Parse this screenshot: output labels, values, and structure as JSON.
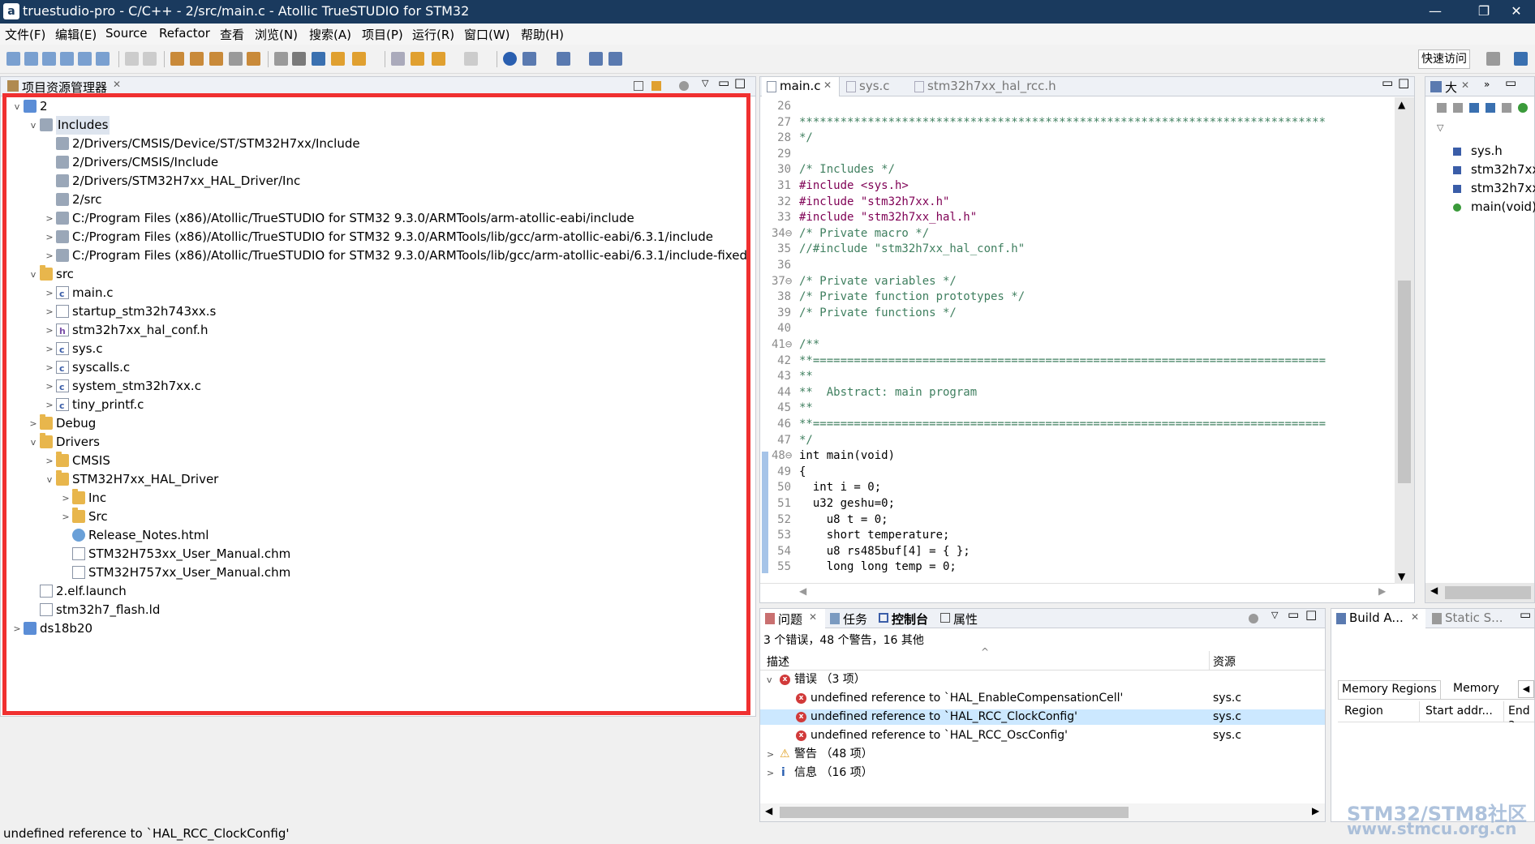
{
  "window": {
    "title": "truestudio-pro  -  C/C++  -  2/src/main.c  -  Atollic TrueSTUDIO for STM32",
    "minimize": "—",
    "maximize": "❐",
    "close": "✕"
  },
  "menu": [
    "文件(F)",
    "编辑(E)",
    "Source",
    "Refactor",
    "查看",
    "浏览(N)",
    "搜索(A)",
    "项目(P)",
    "运行(R)",
    "窗口(W)",
    "帮助(H)"
  ],
  "toolbar": {
    "quick_access": "快速访问"
  },
  "explorer": {
    "tab_label": "项目资源管理器",
    "tree": [
      {
        "depth": 0,
        "arrow": "open",
        "icon": "proj",
        "label": "2"
      },
      {
        "depth": 1,
        "arrow": "open",
        "icon": "inc",
        "label": "Includes",
        "selected": true
      },
      {
        "depth": 2,
        "arrow": "",
        "icon": "inc",
        "label": "2/Drivers/CMSIS/Device/ST/STM32H7xx/Include"
      },
      {
        "depth": 2,
        "arrow": "",
        "icon": "inc",
        "label": "2/Drivers/CMSIS/Include"
      },
      {
        "depth": 2,
        "arrow": "",
        "icon": "inc",
        "label": "2/Drivers/STM32H7xx_HAL_Driver/Inc"
      },
      {
        "depth": 2,
        "arrow": "",
        "icon": "inc",
        "label": "2/src"
      },
      {
        "depth": 2,
        "arrow": "closed",
        "icon": "inc",
        "label": "C:/Program Files (x86)/Atollic/TrueSTUDIO for STM32 9.3.0/ARMTools/arm-atollic-eabi/include"
      },
      {
        "depth": 2,
        "arrow": "closed",
        "icon": "inc",
        "label": "C:/Program Files (x86)/Atollic/TrueSTUDIO for STM32 9.3.0/ARMTools/lib/gcc/arm-atollic-eabi/6.3.1/include"
      },
      {
        "depth": 2,
        "arrow": "closed",
        "icon": "inc",
        "label": "C:/Program Files (x86)/Atollic/TrueSTUDIO for STM32 9.3.0/ARMTools/lib/gcc/arm-atollic-eabi/6.3.1/include-fixed"
      },
      {
        "depth": 1,
        "arrow": "open",
        "icon": "srcfolder",
        "label": "src"
      },
      {
        "depth": 2,
        "arrow": "closed",
        "icon": "cfile",
        "label": "main.c"
      },
      {
        "depth": 2,
        "arrow": "closed",
        "icon": "file",
        "label": "startup_stm32h743xx.s"
      },
      {
        "depth": 2,
        "arrow": "closed",
        "icon": "hfile",
        "label": "stm32h7xx_hal_conf.h"
      },
      {
        "depth": 2,
        "arrow": "closed",
        "icon": "cfile",
        "label": "sys.c"
      },
      {
        "depth": 2,
        "arrow": "closed",
        "icon": "cfile",
        "label": "syscalls.c"
      },
      {
        "depth": 2,
        "arrow": "closed",
        "icon": "cfile",
        "label": "system_stm32h7xx.c"
      },
      {
        "depth": 2,
        "arrow": "closed",
        "icon": "cfile",
        "label": "tiny_printf.c"
      },
      {
        "depth": 1,
        "arrow": "closed",
        "icon": "folder",
        "label": "Debug"
      },
      {
        "depth": 1,
        "arrow": "open",
        "icon": "folder",
        "label": "Drivers"
      },
      {
        "depth": 2,
        "arrow": "closed",
        "icon": "folder",
        "label": "CMSIS"
      },
      {
        "depth": 2,
        "arrow": "open",
        "icon": "folder",
        "label": "STM32H7xx_HAL_Driver"
      },
      {
        "depth": 3,
        "arrow": "closed",
        "icon": "folder",
        "label": "Inc"
      },
      {
        "depth": 3,
        "arrow": "closed",
        "icon": "folder",
        "label": "Src"
      },
      {
        "depth": 3,
        "arrow": "",
        "icon": "globe",
        "label": "Release_Notes.html"
      },
      {
        "depth": 3,
        "arrow": "",
        "icon": "file",
        "label": "STM32H753xx_User_Manual.chm"
      },
      {
        "depth": 3,
        "arrow": "",
        "icon": "file",
        "label": "STM32H757xx_User_Manual.chm"
      },
      {
        "depth": 1,
        "arrow": "",
        "icon": "file",
        "label": "2.elf.launch"
      },
      {
        "depth": 1,
        "arrow": "",
        "icon": "file",
        "label": "stm32h7_flash.ld"
      },
      {
        "depth": 0,
        "arrow": "closed",
        "icon": "proj",
        "label": "ds18b20"
      }
    ]
  },
  "editor": {
    "tabs": [
      {
        "label": "main.c",
        "active": true
      },
      {
        "label": "sys.c"
      },
      {
        "label": "stm32h7xx_hal_rcc.h"
      }
    ],
    "lines": [
      {
        "n": "26",
        "t": ""
      },
      {
        "n": "27",
        "t": "*****************************************************************************",
        "c": "cm"
      },
      {
        "n": "28",
        "t": "*/",
        "c": "cm"
      },
      {
        "n": "29",
        "t": ""
      },
      {
        "n": "30",
        "t": "/* Includes */",
        "c": "cm"
      },
      {
        "n": "31",
        "t": "#include <sys.h>",
        "c": "inc"
      },
      {
        "n": "32",
        "t": "#include \"stm32h7xx.h\"",
        "c": "inc"
      },
      {
        "n": "33",
        "t": "#include \"stm32h7xx_hal.h\"",
        "c": "inc"
      },
      {
        "n": "34⊖",
        "t": "/* Private macro */",
        "c": "cm"
      },
      {
        "n": "35",
        "t": "//#include \"stm32h7xx_hal_conf.h\"",
        "c": "cm"
      },
      {
        "n": "36",
        "t": ""
      },
      {
        "n": "37⊖",
        "t": "/* Private variables */",
        "c": "cm"
      },
      {
        "n": "38",
        "t": "/* Private function prototypes */",
        "c": "cm"
      },
      {
        "n": "39",
        "t": "/* Private functions */",
        "c": "cm"
      },
      {
        "n": "40",
        "t": ""
      },
      {
        "n": "41⊖",
        "t": "/**",
        "c": "cm"
      },
      {
        "n": "42",
        "t": "**===========================================================================",
        "c": "cm"
      },
      {
        "n": "43",
        "t": "**",
        "c": "cm"
      },
      {
        "n": "44",
        "t": "**  Abstract: main program",
        "c": "cm"
      },
      {
        "n": "45",
        "t": "**",
        "c": "cm"
      },
      {
        "n": "46",
        "t": "**===========================================================================",
        "c": "cm"
      },
      {
        "n": "47",
        "t": "*/",
        "c": "cm"
      },
      {
        "n": "48⊖",
        "t": "int main(void)",
        "c": "fn"
      },
      {
        "n": "49",
        "t": "{"
      },
      {
        "n": "50",
        "t": "  int i = 0;",
        "c": "int"
      },
      {
        "n": "51",
        "t": "  u32 geshu=0;"
      },
      {
        "n": "52",
        "t": "    u8 t = 0;"
      },
      {
        "n": "53",
        "t": "    short temperature;",
        "c": "short"
      },
      {
        "n": "54",
        "t": "    u8 rs485buf[4] = { };"
      },
      {
        "n": "55",
        "t": "    long long temp = 0;",
        "c": "long"
      }
    ]
  },
  "outline": {
    "tab_label": "大",
    "items": [
      "sys.h",
      "stm32h7xx",
      "stm32h7xx",
      "main(void)"
    ]
  },
  "problems": {
    "tabs": [
      "问题",
      "任务",
      "控制台",
      "属性"
    ],
    "summary": "3 个错误，48 个警告，16 其他",
    "col_desc": "描述",
    "col_res": "资源",
    "errors_group": "错误 （3 项）",
    "errors": [
      {
        "msg": "undefined reference to `HAL_EnableCompensationCell'",
        "res": "sys.c"
      },
      {
        "msg": "undefined reference to `HAL_RCC_ClockConfig'",
        "res": "sys.c",
        "selected": true
      },
      {
        "msg": "undefined reference to `HAL_RCC_OscConfig'",
        "res": "sys.c"
      }
    ],
    "warnings_group": "警告 （48 项）",
    "info_group": "信息 （16 项）"
  },
  "build": {
    "tabs": [
      "Build A...",
      "Static S..."
    ],
    "mem_tabs": [
      "Memory Regions",
      "Memory"
    ],
    "cols": [
      "Region",
      "Start addr...",
      "End a"
    ]
  },
  "status": {
    "text": "undefined reference to `HAL_RCC_ClockConfig'"
  },
  "watermark": {
    "line1": "STM32/STM8社区",
    "line2": "www.stmcu.org.cn"
  },
  "colors": {
    "highlight": "#f03030",
    "selection": "#cce8ff",
    "title_bg": "#1a3a5e"
  }
}
